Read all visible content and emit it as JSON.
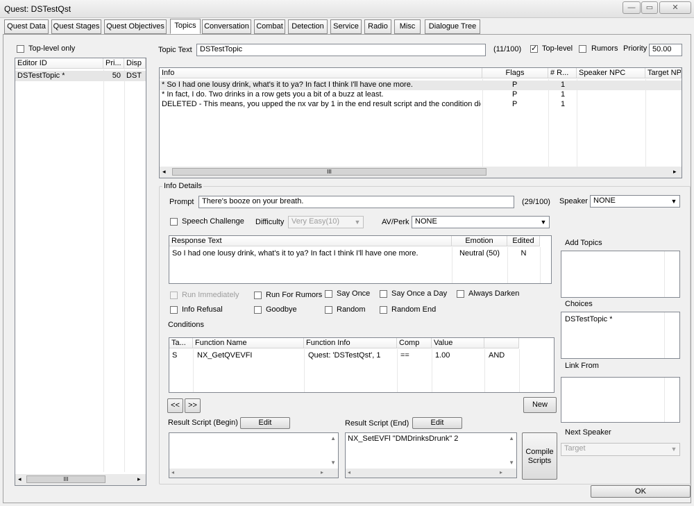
{
  "window": {
    "title": "Quest: DSTestQst",
    "minimize": "—",
    "maximize": "▭",
    "close": "✕"
  },
  "tabs": [
    "Quest Data",
    "Quest Stages",
    "Quest Objectives",
    "Topics",
    "Conversation",
    "Combat",
    "Detection",
    "Service",
    "Radio",
    "Misc",
    "Dialogue Tree"
  ],
  "active_tab": "Topics",
  "left": {
    "toplevel_only_label": "Top-level only",
    "columns": [
      "Editor ID",
      "Pri...",
      "Disp"
    ],
    "rows": [
      {
        "editor_id": "DSTestTopic *",
        "priority": "50",
        "disp": "DST"
      }
    ],
    "hscroll_thumb": "III"
  },
  "topic": {
    "label": "Topic Text",
    "value": "DSTestTopic",
    "count": "(11/100)",
    "toplevel_label": "Top-level",
    "rumors_label": "Rumors",
    "priority_label": "Priority",
    "priority_value": "50.00"
  },
  "info_list": {
    "columns": [
      "Info",
      "Flags",
      "# R...",
      "Speaker NPC",
      "Target NP"
    ],
    "rows": [
      {
        "info": "* So I had one lousy drink, what's it to ya? In fact I think I'll have one more.",
        "flags": "P",
        "r": "1"
      },
      {
        "info": "* In fact, I do. Two drinks in a row gets you a bit of a buzz at least.",
        "flags": "P",
        "r": "1"
      },
      {
        "info": "DELETED - This means, you upped the nx var by 1 in the end result script and the condition did...",
        "flags": "P",
        "r": "1"
      }
    ],
    "hscroll_thumb": "III"
  },
  "info_details": {
    "group_label": "Info Details",
    "prompt_label": "Prompt",
    "prompt_value": "There's booze on your breath.",
    "prompt_count": "(29/100)",
    "speaker_label": "Speaker",
    "speaker_value": "NONE",
    "speech_challenge_label": "Speech Challenge",
    "difficulty_label": "Difficulty",
    "difficulty_value": "Very Easy(10)",
    "avperk_label": "AV/Perk",
    "avperk_value": "NONE",
    "responses": {
      "columns": [
        "Response Text",
        "Emotion",
        "Edited"
      ],
      "rows": [
        {
          "text": "So I had one lousy drink, what's it to ya? In fact I think I'll have one more.",
          "emotion": "Neutral (50)",
          "edited": "N"
        }
      ]
    },
    "flags": {
      "run_immediately": "Run Immediately",
      "run_for_rumors": "Run For Rumors",
      "say_once": "Say Once",
      "say_once_a_day": "Say Once a Day",
      "always_darken": "Always Darken",
      "info_refusal": "Info Refusal",
      "goodbye": "Goodbye",
      "random": "Random",
      "random_end": "Random End"
    },
    "conditions_label": "Conditions",
    "conditions": {
      "columns": [
        "Ta...",
        "Function Name",
        "Function Info",
        "Comp",
        "Value",
        ""
      ],
      "rows": [
        {
          "target": "S",
          "function": "NX_GetQVEVFI",
          "info": "Quest: 'DSTestQst', 1",
          "comp": "==",
          "value": "1.00",
          "op": "AND"
        }
      ]
    },
    "prev_button": "<<",
    "next_button": ">>",
    "new_button": "New",
    "result_begin_label": "Result Script (Begin)",
    "result_end_label": "Result Script (End)",
    "edit_label": "Edit",
    "result_begin_value": "",
    "result_end_value": "NX_SetEVFl \"DMDrinksDrunk\" 2",
    "compile_label_1": "Compile",
    "compile_label_2": "Scripts"
  },
  "right": {
    "add_topics_label": "Add Topics",
    "choices_label": "Choices",
    "choices_items": [
      "DSTestTopic *"
    ],
    "link_from_label": "Link From",
    "next_speaker_label": "Next Speaker",
    "next_speaker_value": "Target"
  },
  "ok_button": "OK",
  "checkbox_states": {
    "toplevel_only": false,
    "toplevel": true,
    "rumors": false,
    "speech_challenge": false
  }
}
